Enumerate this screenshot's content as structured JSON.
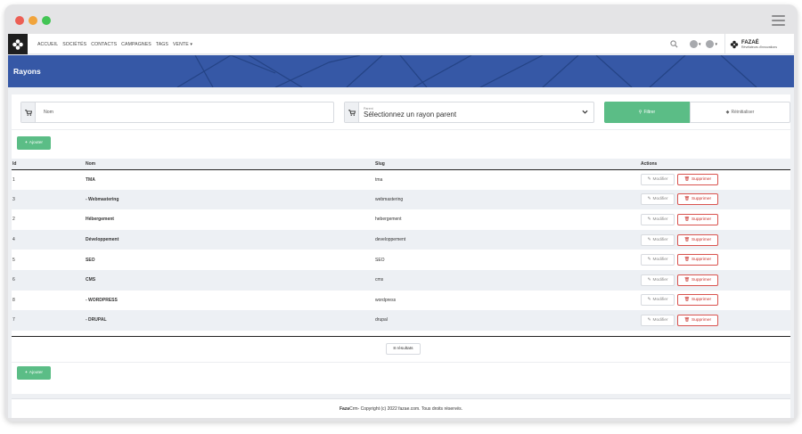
{
  "nav": {
    "items": [
      "ACCUEIL",
      "SOCIÉTÉS",
      "CONTACTS",
      "CAMPAGNES",
      "TAGS",
      "VENTE"
    ],
    "brand_name": "FAZAÉ",
    "brand_tagline": "Révélateurs d'innovations"
  },
  "page": {
    "title": "Rayons"
  },
  "filters": {
    "name_placeholder": "Nom",
    "parent_label": "Parent",
    "parent_value": "Sélectionnez un rayon parent",
    "filter_button": "Filtrer",
    "reset_button": "Réinitialiser"
  },
  "actions": {
    "add_button": "Ajouter",
    "edit_label": "Modifier",
    "delete_label": "Supprimer"
  },
  "table": {
    "headers": {
      "id": "Id",
      "name": "Nom",
      "slug": "Slug",
      "actions": "Actions"
    },
    "rows": [
      {
        "id": "1",
        "name": "TMA",
        "slug": "tma"
      },
      {
        "id": "3",
        "name": "- Webmastering",
        "slug": "webmastering"
      },
      {
        "id": "2",
        "name": "Hébergement",
        "slug": "hebergement"
      },
      {
        "id": "4",
        "name": "Développement",
        "slug": "developpement"
      },
      {
        "id": "5",
        "name": "SEO",
        "slug": "SEO"
      },
      {
        "id": "6",
        "name": "CMS",
        "slug": "cms"
      },
      {
        "id": "8",
        "name": "- WORDPRESS",
        "slug": "wordpress"
      },
      {
        "id": "7",
        "name": "- DRUPAL",
        "slug": "drupal"
      }
    ]
  },
  "pagination": {
    "results": "8 résultats"
  },
  "footer": {
    "brand_bold": "Faza",
    "brand_rest": "Crm",
    "copyright": " - Copyright (c) 2022 fazae.com. Tous droits réservés."
  },
  "colors": {
    "primary": "#3658a6",
    "success": "#5bbd86",
    "danger": "#d9534f"
  },
  "icons": [
    "menu-icon",
    "search-icon",
    "cart-icon",
    "filter-search-icon",
    "eraser-icon",
    "plus-icon",
    "pencil-icon",
    "trash-icon",
    "chevron-down-icon",
    "user-icon"
  ]
}
